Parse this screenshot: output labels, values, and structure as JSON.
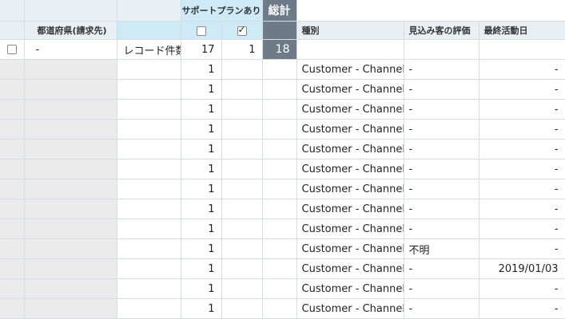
{
  "header": {
    "support_group_label": "サポートプランあり",
    "total_label": "総計",
    "state_label": "都道府県(請求先)",
    "col_type": "種別",
    "col_prospect": "見込み客の評価",
    "col_last_activity": "最終活動日"
  },
  "summary": {
    "state_value": "-",
    "record_count_label": "レコード件数",
    "unchecked_count": "17",
    "checked_count": "1",
    "total": "18"
  },
  "rows": [
    {
      "count": "1",
      "type": "Customer - Channel",
      "prospect": "-",
      "last_activity": "-"
    },
    {
      "count": "1",
      "type": "Customer - Channel",
      "prospect": "-",
      "last_activity": "-"
    },
    {
      "count": "1",
      "type": "Customer - Channel",
      "prospect": "-",
      "last_activity": "-"
    },
    {
      "count": "1",
      "type": "Customer - Channel",
      "prospect": "-",
      "last_activity": "-"
    },
    {
      "count": "1",
      "type": "Customer - Channel",
      "prospect": "-",
      "last_activity": "-"
    },
    {
      "count": "1",
      "type": "Customer - Channel",
      "prospect": "-",
      "last_activity": "-"
    },
    {
      "count": "1",
      "type": "Customer - Channel",
      "prospect": "-",
      "last_activity": "-"
    },
    {
      "count": "1",
      "type": "Customer - Channel",
      "prospect": "-",
      "last_activity": "-"
    },
    {
      "count": "1",
      "type": "Customer - Channel",
      "prospect": "-",
      "last_activity": "-"
    },
    {
      "count": "1",
      "type": "Customer - Channel",
      "prospect": "不明",
      "last_activity": "-"
    },
    {
      "count": "1",
      "type": "Customer - Channel",
      "prospect": "-",
      "last_activity": "2019/01/03"
    },
    {
      "count": "1",
      "type": "Customer - Channel",
      "prospect": "-",
      "last_activity": "-"
    },
    {
      "count": "1",
      "type": "Customer - Channel",
      "prospect": "-",
      "last_activity": "-"
    }
  ]
}
